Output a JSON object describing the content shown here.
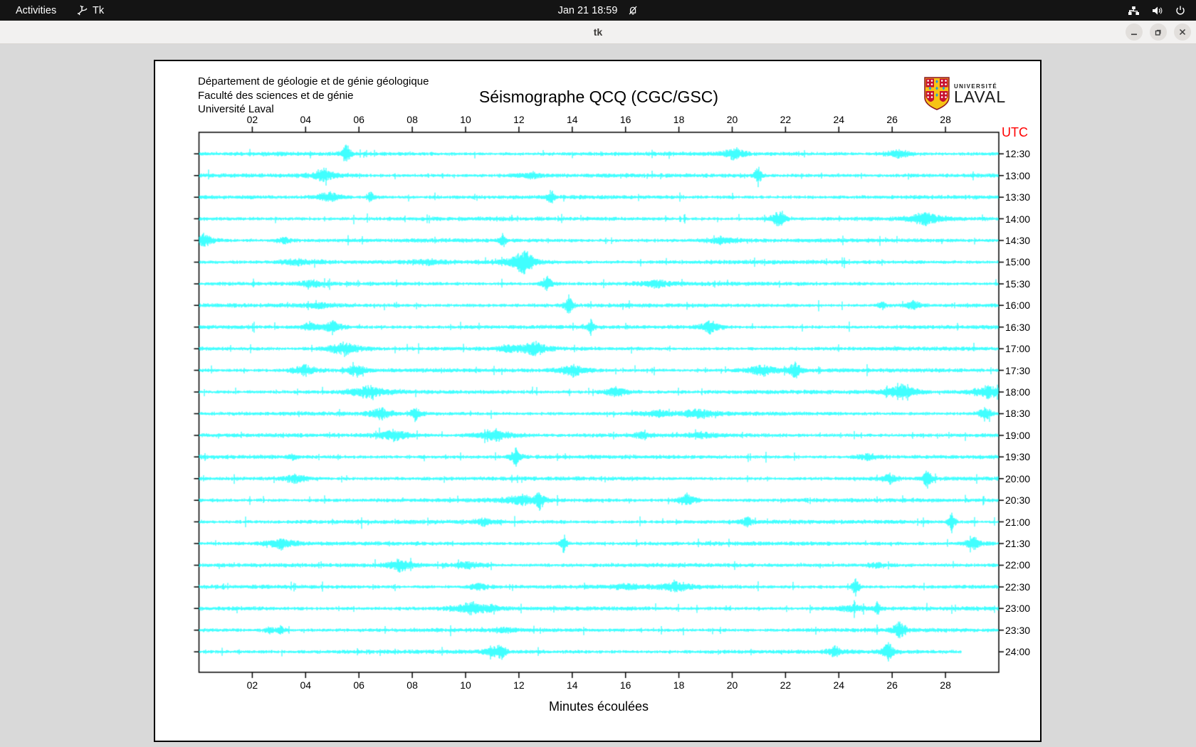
{
  "topbar": {
    "activities": "Activities",
    "app_name": "Tk",
    "clock": "Jan 21  18:59",
    "system_icons": [
      "network",
      "volume",
      "power"
    ],
    "notifications": "disabled"
  },
  "window": {
    "title": "tk",
    "controls": [
      "minimize",
      "maximize",
      "close"
    ]
  },
  "seismograph": {
    "header_lines": [
      "Département de géologie et de génie géologique",
      "Faculté des sciences et de génie",
      "Université Laval"
    ],
    "title": "Séismographe QCQ (CGC/GSC)",
    "utc_label": "UTC",
    "x_label": "Minutes écoulées",
    "x_ticks": [
      "02",
      "04",
      "06",
      "08",
      "10",
      "12",
      "14",
      "16",
      "18",
      "20",
      "22",
      "24",
      "26",
      "28"
    ],
    "x_range_minutes": [
      0,
      30
    ],
    "row_labels": [
      "12:30",
      "13:00",
      "13:30",
      "14:00",
      "14:30",
      "15:00",
      "15:30",
      "16:00",
      "16:30",
      "17:00",
      "17:30",
      "18:00",
      "18:30",
      "19:00",
      "19:30",
      "20:00",
      "20:30",
      "21:00",
      "21:30",
      "22:00",
      "22:30",
      "23:00",
      "23:30",
      "24:00"
    ],
    "last_row_end_fraction": 0.954,
    "trace_color": "#00ffff",
    "utc_color": "#ff0000",
    "logo": {
      "small": "UNIVERSITÉ",
      "large": "LAVAL"
    }
  }
}
